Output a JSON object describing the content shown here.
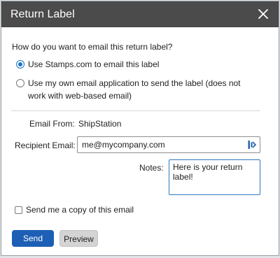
{
  "dialog": {
    "title": "Return Label",
    "close_icon": "close-icon"
  },
  "email_method": {
    "question": "How do you want to email this return label?",
    "options": [
      {
        "label": "Use Stamps.com to email this label",
        "selected": true
      },
      {
        "label": "Use my own email application to send the label (does not work with web-based email)",
        "selected": false
      }
    ]
  },
  "form": {
    "email_from_label": "Email From:",
    "email_from_value": "ShipStation",
    "recipient_label": "Recipient Email:",
    "recipient_value": "me@mycompany.com",
    "recipient_icon": "autofill-icon",
    "notes_label": "Notes:",
    "notes_value": "Here is your return label!"
  },
  "copy_option": {
    "label": "Send me a copy of this email",
    "checked": false
  },
  "buttons": {
    "send_label": "Send",
    "preview_label": "Preview"
  },
  "colors": {
    "titlebar": "#4b4b4b",
    "primary": "#1d5fb4",
    "focus_border": "#2b79c2",
    "radio_selected": "#1a73c8"
  }
}
